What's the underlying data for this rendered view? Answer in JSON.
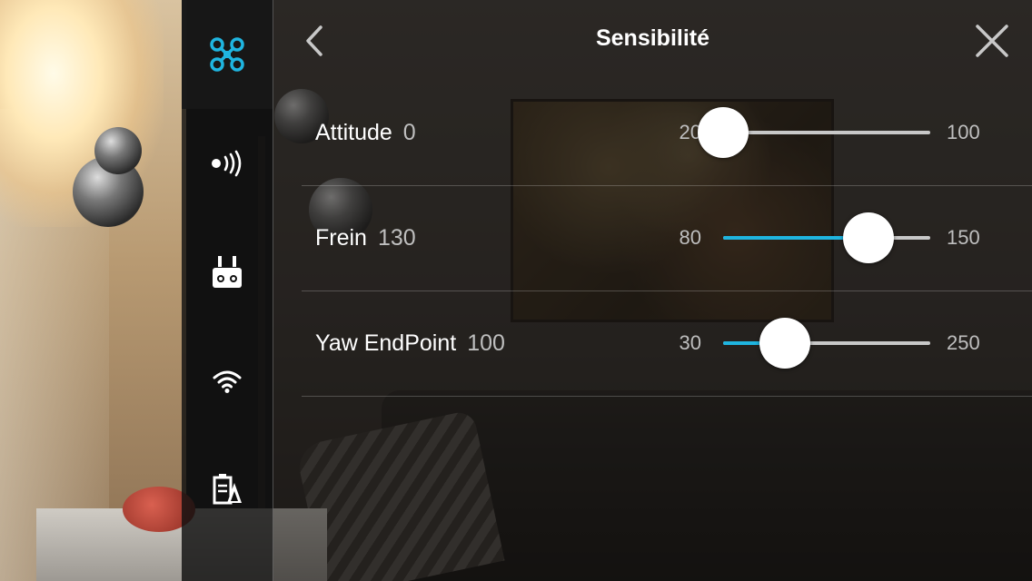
{
  "header": {
    "title": "Sensibilité",
    "back_icon": "chevron-left-icon",
    "close_icon": "close-icon"
  },
  "sidebar": {
    "items": [
      {
        "name": "aircraft-icon",
        "active": true
      },
      {
        "name": "signal-icon",
        "active": false
      },
      {
        "name": "remote-controller-icon",
        "active": false
      },
      {
        "name": "wifi-icon",
        "active": false
      },
      {
        "name": "battery-icon",
        "active": false
      }
    ]
  },
  "settings": [
    {
      "label": "Attitude",
      "value": "0",
      "min": "20",
      "max": "100",
      "fraction": 0.0
    },
    {
      "label": "Frein",
      "value": "130",
      "min": "80",
      "max": "150",
      "fraction": 0.7
    },
    {
      "label": "Yaw EndPoint",
      "value": "100",
      "min": "30",
      "max": "250",
      "fraction": 0.3
    }
  ],
  "colors": {
    "accent": "#1fb5e0",
    "track": "#c8c8c8",
    "text": "#ffffff",
    "secondary_text": "#bfbfbf"
  }
}
